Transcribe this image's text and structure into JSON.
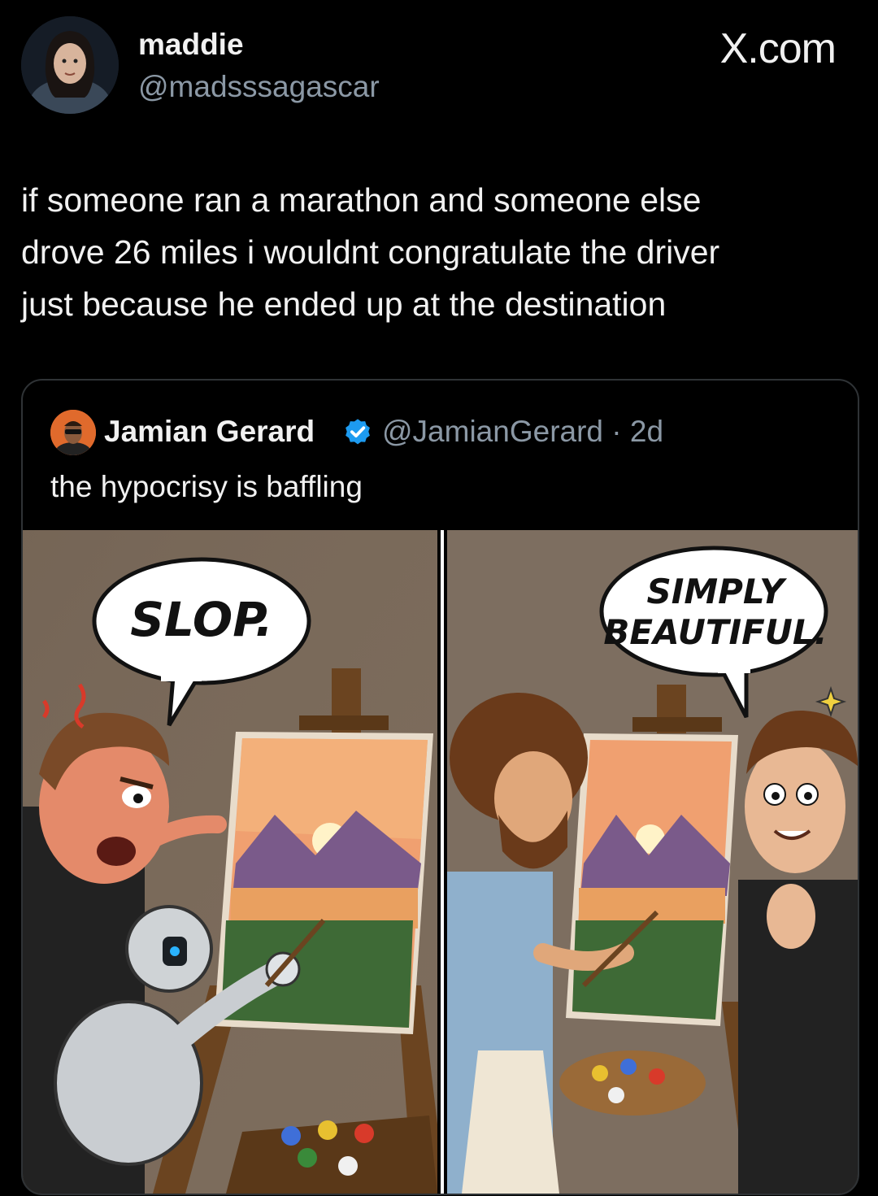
{
  "post": {
    "display_name": "maddie",
    "handle": "@madsssagascar",
    "site_mark": "X.com",
    "text_lines": [
      "if someone ran a marathon and someone else",
      "drove 26 miles i wouldnt congratulate the driver",
      "just because he ended up at the destination"
    ]
  },
  "quoted": {
    "display_name": "Jamian Gerard",
    "verified": true,
    "handle_time": "@JamianGerard · 2d",
    "text": "the hypocrisy is baffling"
  },
  "comic": {
    "left_bubble": "SLOP.",
    "right_bubble_lines": [
      "SIMPLY",
      "BEAUTIFUL."
    ]
  },
  "colors": {
    "background": "#000000",
    "text_primary": "#f1f1f1",
    "text_secondary": "#8b98a5",
    "verified_blue": "#1d9bf0",
    "card_border": "#2f3336"
  }
}
